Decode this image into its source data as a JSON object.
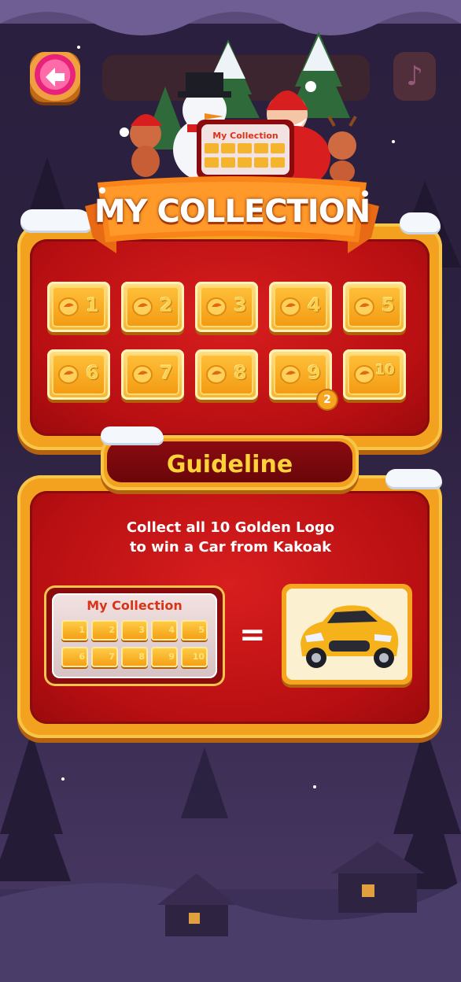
{
  "header": {
    "back_icon": "arrow-left-icon",
    "music_icon": "music-note-icon",
    "banner_label": "My Collection"
  },
  "collection": {
    "title": "MY COLLECTION",
    "slots": [
      {
        "number": "1"
      },
      {
        "number": "2"
      },
      {
        "number": "3"
      },
      {
        "number": "4"
      },
      {
        "number": "5"
      },
      {
        "number": "6"
      },
      {
        "number": "7"
      },
      {
        "number": "8"
      },
      {
        "number": "9",
        "count": "2"
      },
      {
        "number": "10"
      }
    ]
  },
  "guideline": {
    "title": "Guideline",
    "line1": "Collect all 10 Golden Logo",
    "line2": "to win a Car from Kakoak",
    "mini_title": "My Collection",
    "equals": "=",
    "prize_icon": "yellow-car-icon"
  },
  "colors": {
    "panel_red": "#c0141a",
    "panel_gold": "#f2a21e",
    "slot_gold": "#f5b42e",
    "guide_text": "#ffd23a",
    "badge": "#f7a51e"
  }
}
